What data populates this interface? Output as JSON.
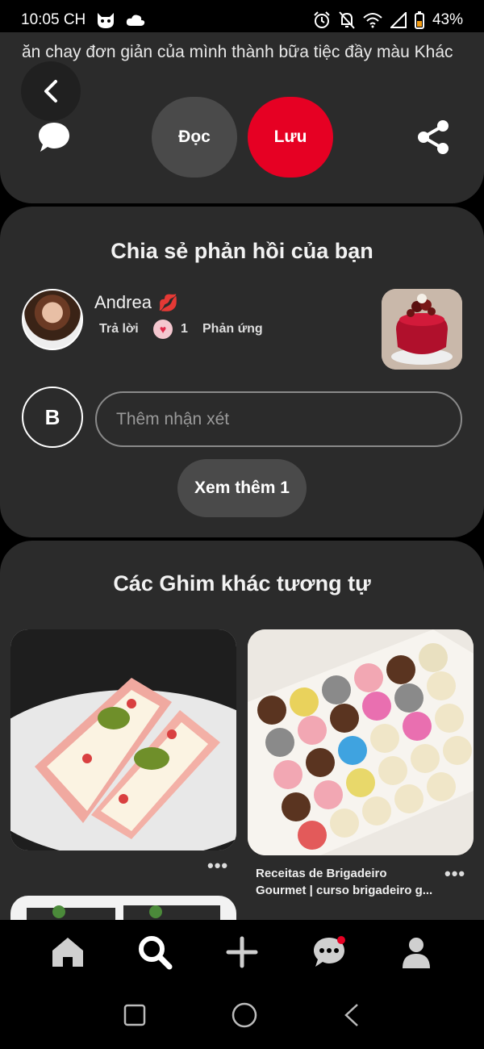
{
  "status_bar": {
    "time": "10:05 CH",
    "battery": "43%",
    "icons": [
      "cat-face-icon",
      "cloud-icon",
      "alarm-icon",
      "bell-off-icon",
      "wifi-icon",
      "cell-signal-icon",
      "battery-icon"
    ]
  },
  "pin": {
    "description": "ăn chay đơn giản của mình thành bữa tiệc đầy màu Khác",
    "read_label": "Đọc",
    "save_label": "Lưu"
  },
  "feedback": {
    "title": "Chia sẻ phản hồi của bạn",
    "comment": {
      "author": "Andrea",
      "reply_label": "Trả lời",
      "reaction_count": "1",
      "react_label": "Phản ứng"
    },
    "current_user_initial": "B",
    "input_placeholder": "Thêm nhận xét",
    "see_more_label": "Xem thêm 1"
  },
  "similar": {
    "title": "Các Ghim khác tương tự",
    "pins": [
      {
        "caption": ""
      },
      {
        "caption": "Receitas de Brigadeiro Gourmet | curso brigadeiro g..."
      }
    ],
    "more_label": "•••"
  },
  "bottom_nav": {
    "items": [
      "home-icon",
      "search-icon",
      "plus-icon",
      "messages-icon",
      "profile-icon"
    ],
    "active": "search-icon"
  },
  "colors": {
    "accent": "#e60023",
    "card_bg": "#2b2b2b",
    "button_bg": "#4a4a4a"
  }
}
